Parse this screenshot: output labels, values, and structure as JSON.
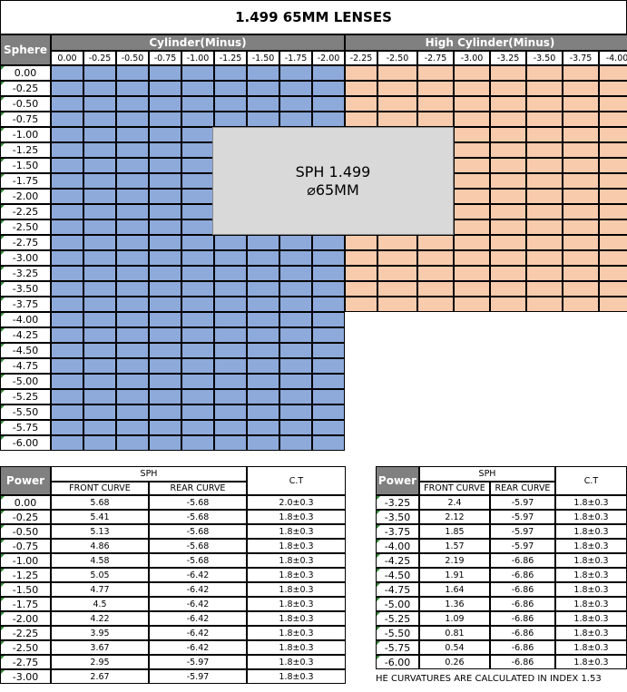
{
  "title": "1.499 65MM LENSES",
  "grid": {
    "sphere_header": "Sphere",
    "cyl_header": "Cylinder(Minus)",
    "high_cyl_header": "High Cylinder(Minus)",
    "cylinders": [
      "0.00",
      "-0.25",
      "-0.50",
      "-0.75",
      "-1.00",
      "-1.25",
      "-1.50",
      "-1.75",
      "-2.00"
    ],
    "high_cylinders": [
      "-2.25",
      "-2.50",
      "-2.75",
      "-3.00",
      "-3.25",
      "-3.50",
      "-3.75",
      "-4.00"
    ],
    "spheres": [
      "0.00",
      "-0.25",
      "-0.50",
      "-0.75",
      "-1.00",
      "-1.25",
      "-1.50",
      "-1.75",
      "-2.00",
      "-2.25",
      "-2.50",
      "-2.75",
      "-3.00",
      "-3.25",
      "-3.50",
      "-3.75",
      "-4.00",
      "-4.25",
      "-4.50",
      "-4.75",
      "-5.00",
      "-5.25",
      "-5.50",
      "-5.75",
      "-6.00"
    ],
    "center_line1": "SPH 1.499",
    "center_line2": "⌀65MM",
    "colors": {
      "available": "#8eaadb",
      "high_available": "#f8cbad",
      "header": "#808080",
      "center": "#d9d9d9"
    }
  },
  "curves": {
    "power_header": "Power",
    "sph_header": "SPH",
    "front_header": "FRONT CURVE",
    "rear_header": "REAR CURVE",
    "ct_header": "C.T",
    "left_rows": [
      [
        "0.00",
        "5.68",
        "-5.68",
        "2.0±0.3"
      ],
      [
        "-0.25",
        "5.41",
        "-5.68",
        "1.8±0.3"
      ],
      [
        "-0.50",
        "5.13",
        "-5.68",
        "1.8±0.3"
      ],
      [
        "-0.75",
        "4.86",
        "-5.68",
        "1.8±0.3"
      ],
      [
        "-1.00",
        "4.58",
        "-5.68",
        "1.8±0.3"
      ],
      [
        "-1.25",
        "5.05",
        "-6.42",
        "1.8±0.3"
      ],
      [
        "-1.50",
        "4.77",
        "-6.42",
        "1.8±0.3"
      ],
      [
        "-1.75",
        "4.5",
        "-6.42",
        "1.8±0.3"
      ],
      [
        "-2.00",
        "4.22",
        "-6.42",
        "1.8±0.3"
      ],
      [
        "-2.25",
        "3.95",
        "-6.42",
        "1.8±0.3"
      ],
      [
        "-2.50",
        "3.67",
        "-6.42",
        "1.8±0.3"
      ],
      [
        "-2.75",
        "2.95",
        "-5.97",
        "1.8±0.3"
      ],
      [
        "-3.00",
        "2.67",
        "-5.97",
        "1.8±0.3"
      ]
    ],
    "right_rows": [
      [
        "-3.25",
        "2.4",
        "-5.97",
        "1.8±0.3"
      ],
      [
        "-3.50",
        "2.12",
        "-5.97",
        "1.8±0.3"
      ],
      [
        "-3.75",
        "1.85",
        "-5.97",
        "1.8±0.3"
      ],
      [
        "-4.00",
        "1.57",
        "-5.97",
        "1.8±0.3"
      ],
      [
        "-4.25",
        "2.19",
        "-6.86",
        "1.8±0.3"
      ],
      [
        "-4.50",
        "1.91",
        "-6.86",
        "1.8±0.3"
      ],
      [
        "-4.75",
        "1.64",
        "-6.86",
        "1.8±0.3"
      ],
      [
        "-5.00",
        "1.36",
        "-6.86",
        "1.8±0.3"
      ],
      [
        "-5.25",
        "1.09",
        "-6.86",
        "1.8±0.3"
      ],
      [
        "-5.50",
        "0.81",
        "-6.86",
        "1.8±0.3"
      ],
      [
        "-5.75",
        "0.54",
        "-6.86",
        "1.8±0.3"
      ],
      [
        "-6.00",
        "0.26",
        "-6.86",
        "1.8±0.3"
      ]
    ],
    "note": "HE CURVATURES ARE CALCULATED IN INDEX 1.53"
  }
}
